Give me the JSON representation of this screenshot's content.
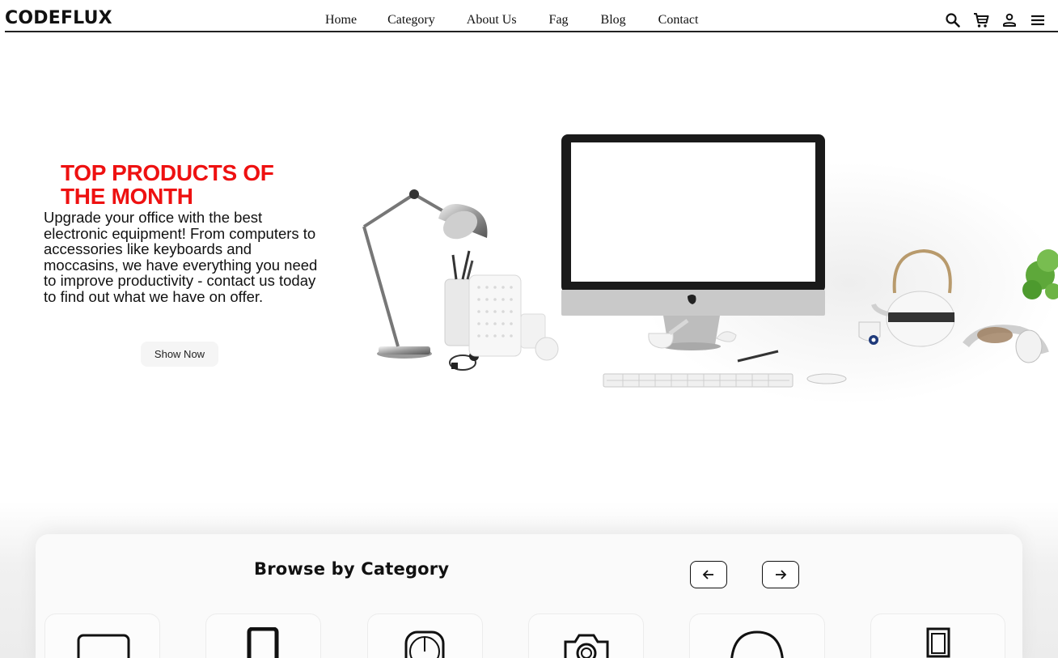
{
  "brand": "CODEFLUX",
  "nav": {
    "items": [
      {
        "label": "Home"
      },
      {
        "label": "Category"
      },
      {
        "label": "About Us"
      },
      {
        "label": "Fag"
      },
      {
        "label": "Blog"
      },
      {
        "label": "Contact"
      }
    ],
    "icons": [
      "search-icon",
      "cart-icon",
      "user-icon",
      "menu-icon"
    ]
  },
  "hero": {
    "title": "TOP PRODUCTS OF THE MONTH",
    "title_color": "#ee1111",
    "text": "Upgrade your office with the best electronic equipment! From computers to accessories like keyboards and moccasins, we have everything you need to improve productivity - contact us today to find out what we have on offer.",
    "button_label": "Show Now"
  },
  "category": {
    "title": "Browse by Category",
    "prev_icon": "arrow-left-icon",
    "next_icon": "arrow-right-icon",
    "tiles": [
      "laptop-icon",
      "tablet-icon",
      "watch-icon",
      "camera-icon",
      "headphones-icon",
      "frame-icon"
    ]
  }
}
